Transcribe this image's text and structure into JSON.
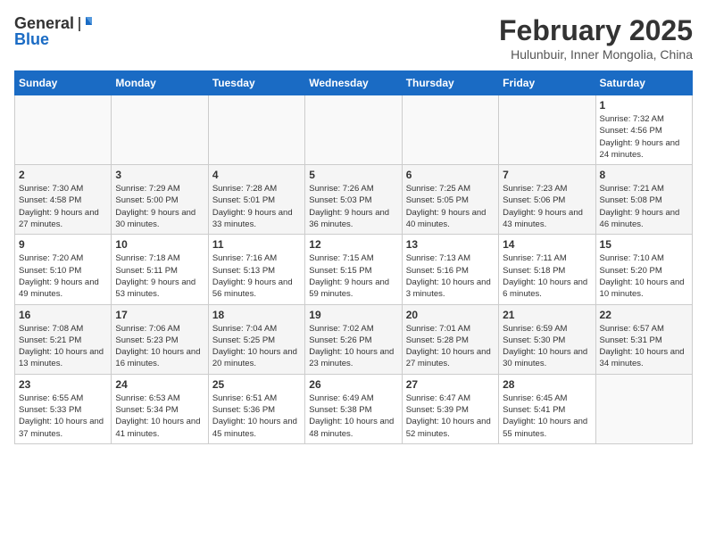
{
  "header": {
    "logo": {
      "line1": "General",
      "line2": "Blue"
    },
    "title": "February 2025",
    "location": "Hulunbuir, Inner Mongolia, China"
  },
  "days_of_week": [
    "Sunday",
    "Monday",
    "Tuesday",
    "Wednesday",
    "Thursday",
    "Friday",
    "Saturday"
  ],
  "weeks": [
    [
      {
        "day": "",
        "info": ""
      },
      {
        "day": "",
        "info": ""
      },
      {
        "day": "",
        "info": ""
      },
      {
        "day": "",
        "info": ""
      },
      {
        "day": "",
        "info": ""
      },
      {
        "day": "",
        "info": ""
      },
      {
        "day": "1",
        "info": "Sunrise: 7:32 AM\nSunset: 4:56 PM\nDaylight: 9 hours and 24 minutes."
      }
    ],
    [
      {
        "day": "2",
        "info": "Sunrise: 7:30 AM\nSunset: 4:58 PM\nDaylight: 9 hours and 27 minutes."
      },
      {
        "day": "3",
        "info": "Sunrise: 7:29 AM\nSunset: 5:00 PM\nDaylight: 9 hours and 30 minutes."
      },
      {
        "day": "4",
        "info": "Sunrise: 7:28 AM\nSunset: 5:01 PM\nDaylight: 9 hours and 33 minutes."
      },
      {
        "day": "5",
        "info": "Sunrise: 7:26 AM\nSunset: 5:03 PM\nDaylight: 9 hours and 36 minutes."
      },
      {
        "day": "6",
        "info": "Sunrise: 7:25 AM\nSunset: 5:05 PM\nDaylight: 9 hours and 40 minutes."
      },
      {
        "day": "7",
        "info": "Sunrise: 7:23 AM\nSunset: 5:06 PM\nDaylight: 9 hours and 43 minutes."
      },
      {
        "day": "8",
        "info": "Sunrise: 7:21 AM\nSunset: 5:08 PM\nDaylight: 9 hours and 46 minutes."
      }
    ],
    [
      {
        "day": "9",
        "info": "Sunrise: 7:20 AM\nSunset: 5:10 PM\nDaylight: 9 hours and 49 minutes."
      },
      {
        "day": "10",
        "info": "Sunrise: 7:18 AM\nSunset: 5:11 PM\nDaylight: 9 hours and 53 minutes."
      },
      {
        "day": "11",
        "info": "Sunrise: 7:16 AM\nSunset: 5:13 PM\nDaylight: 9 hours and 56 minutes."
      },
      {
        "day": "12",
        "info": "Sunrise: 7:15 AM\nSunset: 5:15 PM\nDaylight: 9 hours and 59 minutes."
      },
      {
        "day": "13",
        "info": "Sunrise: 7:13 AM\nSunset: 5:16 PM\nDaylight: 10 hours and 3 minutes."
      },
      {
        "day": "14",
        "info": "Sunrise: 7:11 AM\nSunset: 5:18 PM\nDaylight: 10 hours and 6 minutes."
      },
      {
        "day": "15",
        "info": "Sunrise: 7:10 AM\nSunset: 5:20 PM\nDaylight: 10 hours and 10 minutes."
      }
    ],
    [
      {
        "day": "16",
        "info": "Sunrise: 7:08 AM\nSunset: 5:21 PM\nDaylight: 10 hours and 13 minutes."
      },
      {
        "day": "17",
        "info": "Sunrise: 7:06 AM\nSunset: 5:23 PM\nDaylight: 10 hours and 16 minutes."
      },
      {
        "day": "18",
        "info": "Sunrise: 7:04 AM\nSunset: 5:25 PM\nDaylight: 10 hours and 20 minutes."
      },
      {
        "day": "19",
        "info": "Sunrise: 7:02 AM\nSunset: 5:26 PM\nDaylight: 10 hours and 23 minutes."
      },
      {
        "day": "20",
        "info": "Sunrise: 7:01 AM\nSunset: 5:28 PM\nDaylight: 10 hours and 27 minutes."
      },
      {
        "day": "21",
        "info": "Sunrise: 6:59 AM\nSunset: 5:30 PM\nDaylight: 10 hours and 30 minutes."
      },
      {
        "day": "22",
        "info": "Sunrise: 6:57 AM\nSunset: 5:31 PM\nDaylight: 10 hours and 34 minutes."
      }
    ],
    [
      {
        "day": "23",
        "info": "Sunrise: 6:55 AM\nSunset: 5:33 PM\nDaylight: 10 hours and 37 minutes."
      },
      {
        "day": "24",
        "info": "Sunrise: 6:53 AM\nSunset: 5:34 PM\nDaylight: 10 hours and 41 minutes."
      },
      {
        "day": "25",
        "info": "Sunrise: 6:51 AM\nSunset: 5:36 PM\nDaylight: 10 hours and 45 minutes."
      },
      {
        "day": "26",
        "info": "Sunrise: 6:49 AM\nSunset: 5:38 PM\nDaylight: 10 hours and 48 minutes."
      },
      {
        "day": "27",
        "info": "Sunrise: 6:47 AM\nSunset: 5:39 PM\nDaylight: 10 hours and 52 minutes."
      },
      {
        "day": "28",
        "info": "Sunrise: 6:45 AM\nSunset: 5:41 PM\nDaylight: 10 hours and 55 minutes."
      },
      {
        "day": "",
        "info": ""
      }
    ]
  ]
}
